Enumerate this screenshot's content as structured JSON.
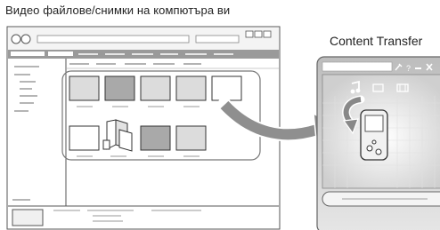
{
  "captions": {
    "left": "Видео файлове/снимки на компютъра ви",
    "right": "Content Transfer"
  },
  "transfer_window": {
    "title_controls": [
      "pin-icon",
      "help-icon",
      "minimize-icon",
      "close-icon"
    ],
    "media_tabs": [
      "music-note-icon",
      "photo-icon",
      "video-film-icon"
    ]
  },
  "colors": {
    "line": "#555555",
    "fill": "#dcdcdc",
    "fill_dark": "#a9a9a9",
    "thumb_border": "#333333",
    "arrow": "#8f8f8f"
  }
}
